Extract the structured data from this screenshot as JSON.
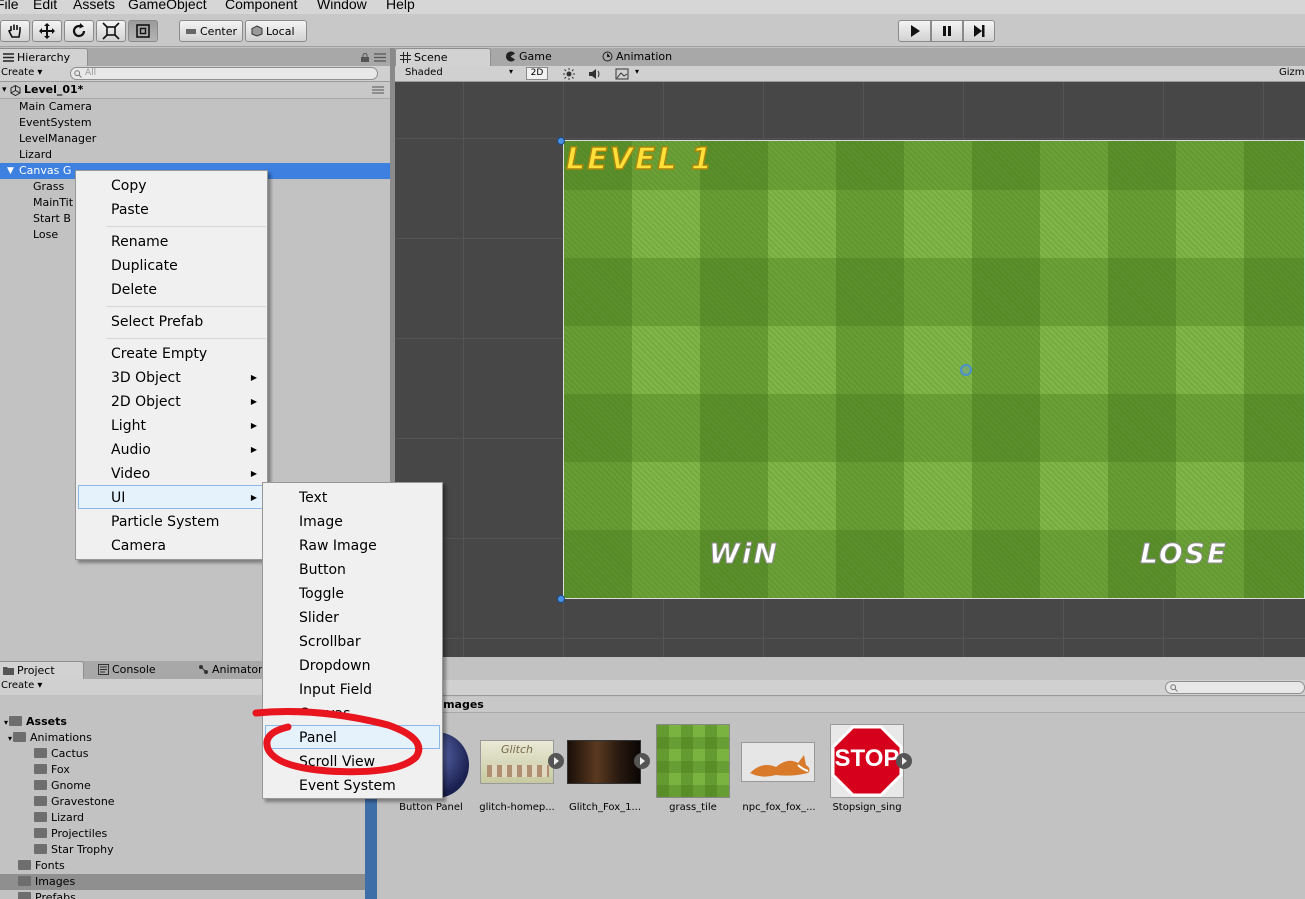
{
  "menubar": [
    "File",
    "Edit",
    "Assets",
    "GameObject",
    "Component",
    "Window",
    "Help"
  ],
  "toolbar": {
    "tools": [
      "hand-icon",
      "move-icon",
      "rotate-icon",
      "scale-icon",
      "rect-icon"
    ],
    "pivot": "Center",
    "space": "Local",
    "play": [
      "play-icon",
      "pause-icon",
      "step-icon"
    ]
  },
  "hierarchy": {
    "tab": "Hierarchy",
    "create": "Create",
    "search_placeholder": "All",
    "scene": "Level_01*",
    "items": [
      "Main Camera",
      "EventSystem",
      "LevelManager",
      "Lizard",
      "Canvas G"
    ],
    "children": [
      "Grass",
      "MainTit",
      "Start B",
      "Lose"
    ]
  },
  "scene_tabs": {
    "scene": "Scene",
    "game": "Game",
    "animation": "Animation"
  },
  "scene_bar": {
    "shading": "Shaded",
    "mode2d": "2D",
    "gizmos": "Gizm"
  },
  "game": {
    "title": "LEVEL 1",
    "win": "WiN",
    "lose": "LOSE"
  },
  "context_menu": {
    "items": [
      "Copy",
      "Paste",
      "Rename",
      "Duplicate",
      "Delete",
      "Select Prefab",
      "Create Empty",
      "3D Object",
      "2D Object",
      "Light",
      "Audio",
      "Video",
      "UI",
      "Particle System",
      "Camera"
    ]
  },
  "ui_submenu": {
    "items": [
      "Text",
      "Image",
      "Raw Image",
      "Button",
      "Toggle",
      "Slider",
      "Scrollbar",
      "Dropdown",
      "Input Field",
      "Canvas",
      "Panel",
      "Scroll View",
      "Event System"
    ]
  },
  "project": {
    "tabs": [
      "Project",
      "Console",
      "Animator"
    ],
    "create": "Create",
    "root": "Assets",
    "animations": "Animations",
    "animation_folders": [
      "Cactus",
      "Fox",
      "Gnome",
      "Gravestone",
      "Lizard",
      "Projectiles",
      "Star Trophy"
    ],
    "folders": [
      "Fonts",
      "Images",
      "Prefabs"
    ],
    "breadcrumb": "Images"
  },
  "assets": [
    {
      "label": "Button Panel"
    },
    {
      "label": "glitch-homep..."
    },
    {
      "label": "Glitch_Fox_1..."
    },
    {
      "label": "grass_tile"
    },
    {
      "label": "npc_fox_fox_..."
    },
    {
      "label": "Stopsign_sing",
      "text": "STOP"
    }
  ],
  "thumb_text": {
    "glitch": "Glitch"
  },
  "colors": {
    "selection": "#3d80df",
    "annotation": "#e8141e",
    "accent_text": "#ffe03a"
  }
}
